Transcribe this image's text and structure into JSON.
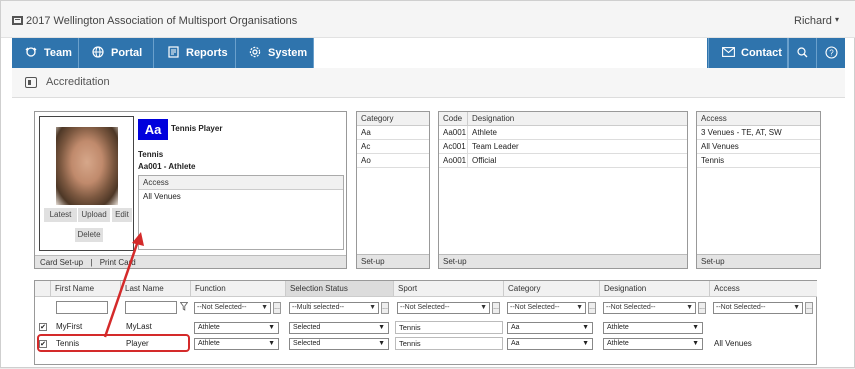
{
  "header": {
    "org_title": "2017 Wellington Association of Multisport Organisations",
    "user_name": "Richard",
    "user_caret": "▾"
  },
  "nav": {
    "team": "Team",
    "portal": "Portal",
    "reports": "Reports",
    "system": "System",
    "contact": "Contact"
  },
  "page": {
    "title": "Accreditation"
  },
  "card": {
    "photo_buttons": {
      "latest": "Latest",
      "upload": "Upload",
      "edit": "Edit",
      "delete": "Delete"
    },
    "badge": "Aa",
    "role": "Tennis Player",
    "sport": "Tennis",
    "code_designation": "Aa001 - Athlete",
    "access_header": "Access",
    "access_value": "All Venues",
    "footer": {
      "card_setup": "Card Set-up",
      "separator": "|",
      "print_card": "Print Card"
    }
  },
  "category_panel": {
    "header": "Category",
    "rows": [
      "Aa",
      "Ac",
      "Ao"
    ],
    "footer": "Set-up"
  },
  "code_panel": {
    "headers": {
      "code": "Code",
      "designation": "Designation"
    },
    "rows": [
      {
        "code": "Aa001",
        "designation": "Athlete"
      },
      {
        "code": "Ac001",
        "designation": "Team Leader"
      },
      {
        "code": "Ao001",
        "designation": "Official"
      }
    ],
    "footer": "Set-up"
  },
  "access_panel": {
    "header": "Access",
    "rows": [
      "3 Venues - TE, AT, SW",
      "All Venues",
      "Tennis"
    ],
    "footer": "Set-up"
  },
  "grid": {
    "columns": {
      "first_name": "First Name",
      "last_name": "Last Name",
      "function": "Function",
      "selection_status": "Selection Status",
      "sport": "Sport",
      "category": "Category",
      "designation": "Designation",
      "access": "Access"
    },
    "filters": {
      "function": "--Not Selected--",
      "selection_status": "--Multi selected--",
      "sport": "--Not Selected--",
      "category": "--Not Selected--",
      "designation": "--Not Selected--",
      "access": "--Not Selected--",
      "button": "..."
    },
    "rows": [
      {
        "first": "MyFirst",
        "last": "MyLast",
        "function": "Athlete",
        "status": "Selected",
        "sport": "Tennis",
        "category": "Aa",
        "designation": "Athlete",
        "access": ""
      },
      {
        "first": "Tennis",
        "last": "Player",
        "function": "Athlete",
        "status": "Selected",
        "sport": "Tennis",
        "category": "Aa",
        "designation": "Athlete",
        "access": "All Venues"
      }
    ],
    "checkmark": "✔"
  },
  "colors": {
    "nav": "#2f74ad",
    "badge": "#0000dd",
    "annotation": "#d42a2a"
  }
}
